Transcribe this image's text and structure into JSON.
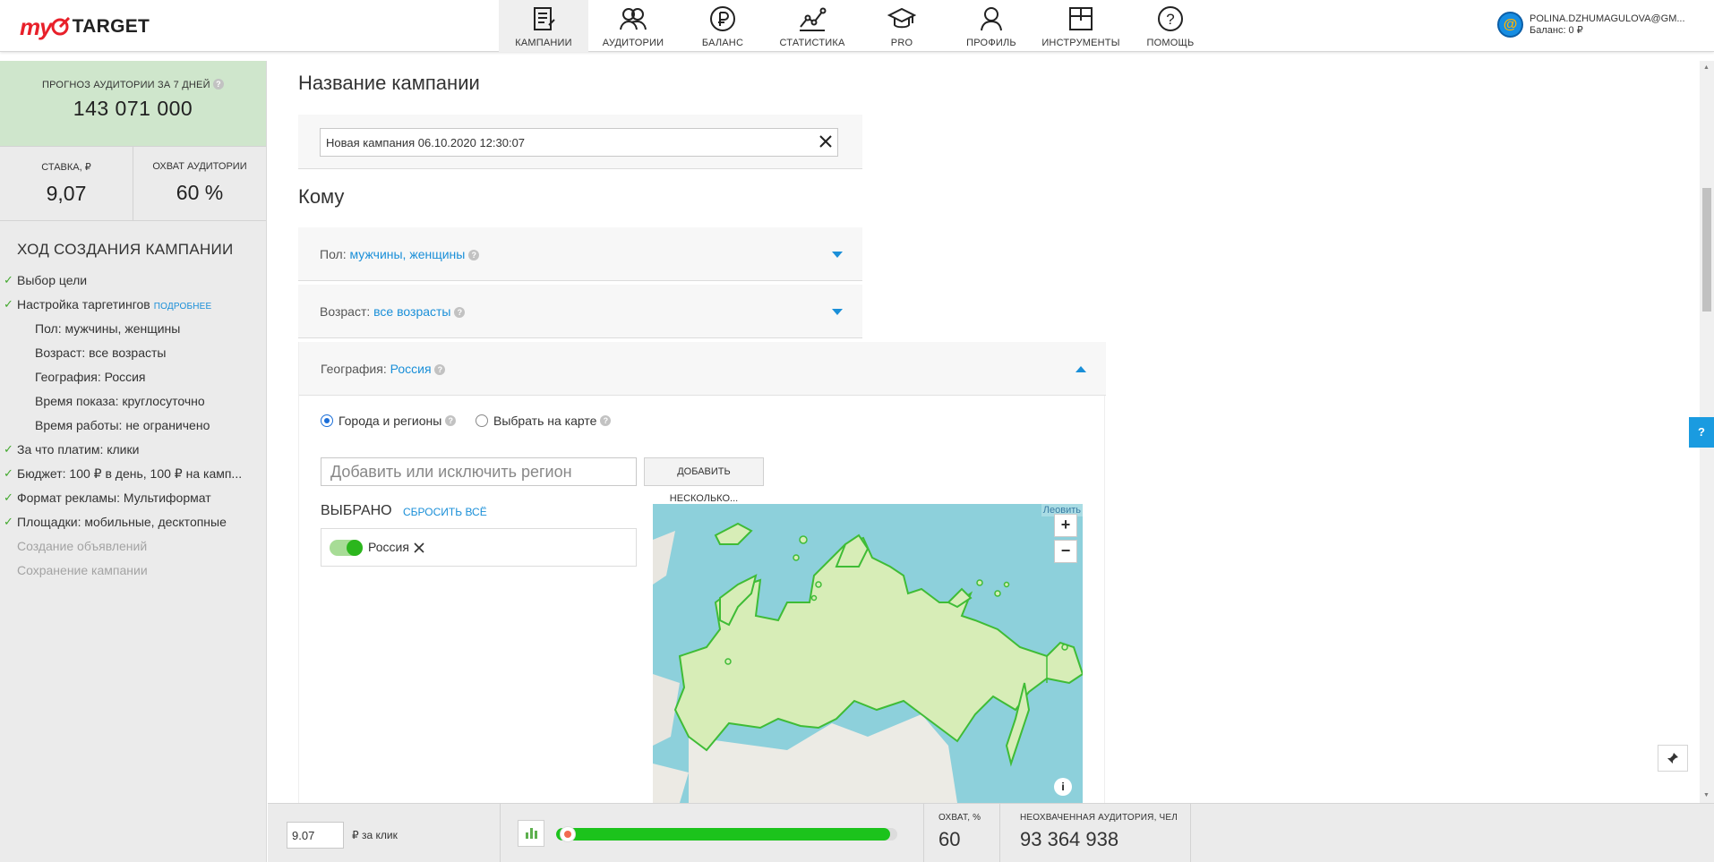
{
  "header": {
    "logo_my": "my",
    "logo_target": "TARGET",
    "nav": [
      {
        "label": "КАМПАНИИ",
        "icon": "campaigns-icon",
        "active": true
      },
      {
        "label": "АУДИТОРИИ",
        "icon": "audiences-icon"
      },
      {
        "label": "БАЛАНС",
        "icon": "ruble-icon"
      },
      {
        "label": "СТАТИСТИКА",
        "icon": "stats-icon"
      },
      {
        "label": "PRO",
        "icon": "graduation-cap-icon"
      },
      {
        "label": "ПРОФИЛЬ",
        "icon": "profile-icon"
      },
      {
        "label": "ИНСТРУМЕНТЫ",
        "icon": "tools-icon"
      },
      {
        "label": "ПОМОЩЬ",
        "icon": "help-icon"
      }
    ],
    "user_email": "POLINA.DZHUMAGULOVA@GM...",
    "balance": "Баланс: 0 ₽"
  },
  "sidebar": {
    "forecast_label": "ПРОГНОЗ АУДИТОРИИ ЗА 7 ДНЕЙ",
    "forecast_value": "143 071 000",
    "bid_label": "СТАВКА, ₽",
    "bid_value": "9,07",
    "reach_label": "ОХВАТ АУДИТОРИИ",
    "reach_value": "60 %",
    "progress_title": "ХОД СОЗДАНИЯ КАМПАНИИ",
    "steps": [
      {
        "label": "Выбор цели"
      },
      {
        "label": "Настройка таргетингов",
        "link": "ПОДРОБНЕЕ"
      },
      {
        "label": "Пол: мужчины, женщины"
      },
      {
        "label": "Возраст: все возрасты"
      },
      {
        "label": "География: Россия"
      },
      {
        "label": "Время показа: круглосуточно"
      },
      {
        "label": "Время работы: не ограничено"
      },
      {
        "label": "За что платим: клики"
      },
      {
        "label": "Бюджет: 100 ₽ в день, 100 ₽ на камп..."
      },
      {
        "label": "Формат рекламы: Мультиформат"
      },
      {
        "label": "Площадки: мобильные, десктопные"
      },
      {
        "label": "Создание объявлений"
      },
      {
        "label": "Сохранение кампании"
      }
    ]
  },
  "main": {
    "campaign_name_title": "Название кампании",
    "campaign_name_value": "Новая кампания 06.10.2020 12:30:07",
    "whom_title": "Кому",
    "gender_label": "Пол:",
    "gender_value": "мужчины, женщины",
    "age_label": "Возраст:",
    "age_value": "все возрасты",
    "geo_label": "География:",
    "geo_value": "Россия",
    "radio_cities": "Города и регионы",
    "radio_map": "Выбрать на карте",
    "region_placeholder": "Добавить или исключить регион",
    "add_many": "ДОБАВИТЬ НЕСКОЛЬКО...",
    "selected_title": "ВЫБРАНО",
    "reset_all": "СБРОСИТЬ ВСЁ",
    "selected_items": [
      "Россия"
    ],
    "map_attribution": "Леовить",
    "zoom_in": "+",
    "zoom_out": "−",
    "info": "i"
  },
  "help_tab": "?",
  "bottom": {
    "bid_input": "9.07",
    "bid_unit": "₽ за клик",
    "slider_fill_fraction": 0.98,
    "reach_label": "ОХВАТ, %",
    "reach_value": "60",
    "unreached_label": "НЕОХВАЧЕННАЯ АУДИТОРИЯ, ЧЕЛ",
    "unreached_value": "93 364 938"
  },
  "colors": {
    "accent": "#1a8fd8",
    "brand_red": "#e8202a",
    "green": "#1cc31c",
    "forecast_bg": "#cfe6cc"
  }
}
